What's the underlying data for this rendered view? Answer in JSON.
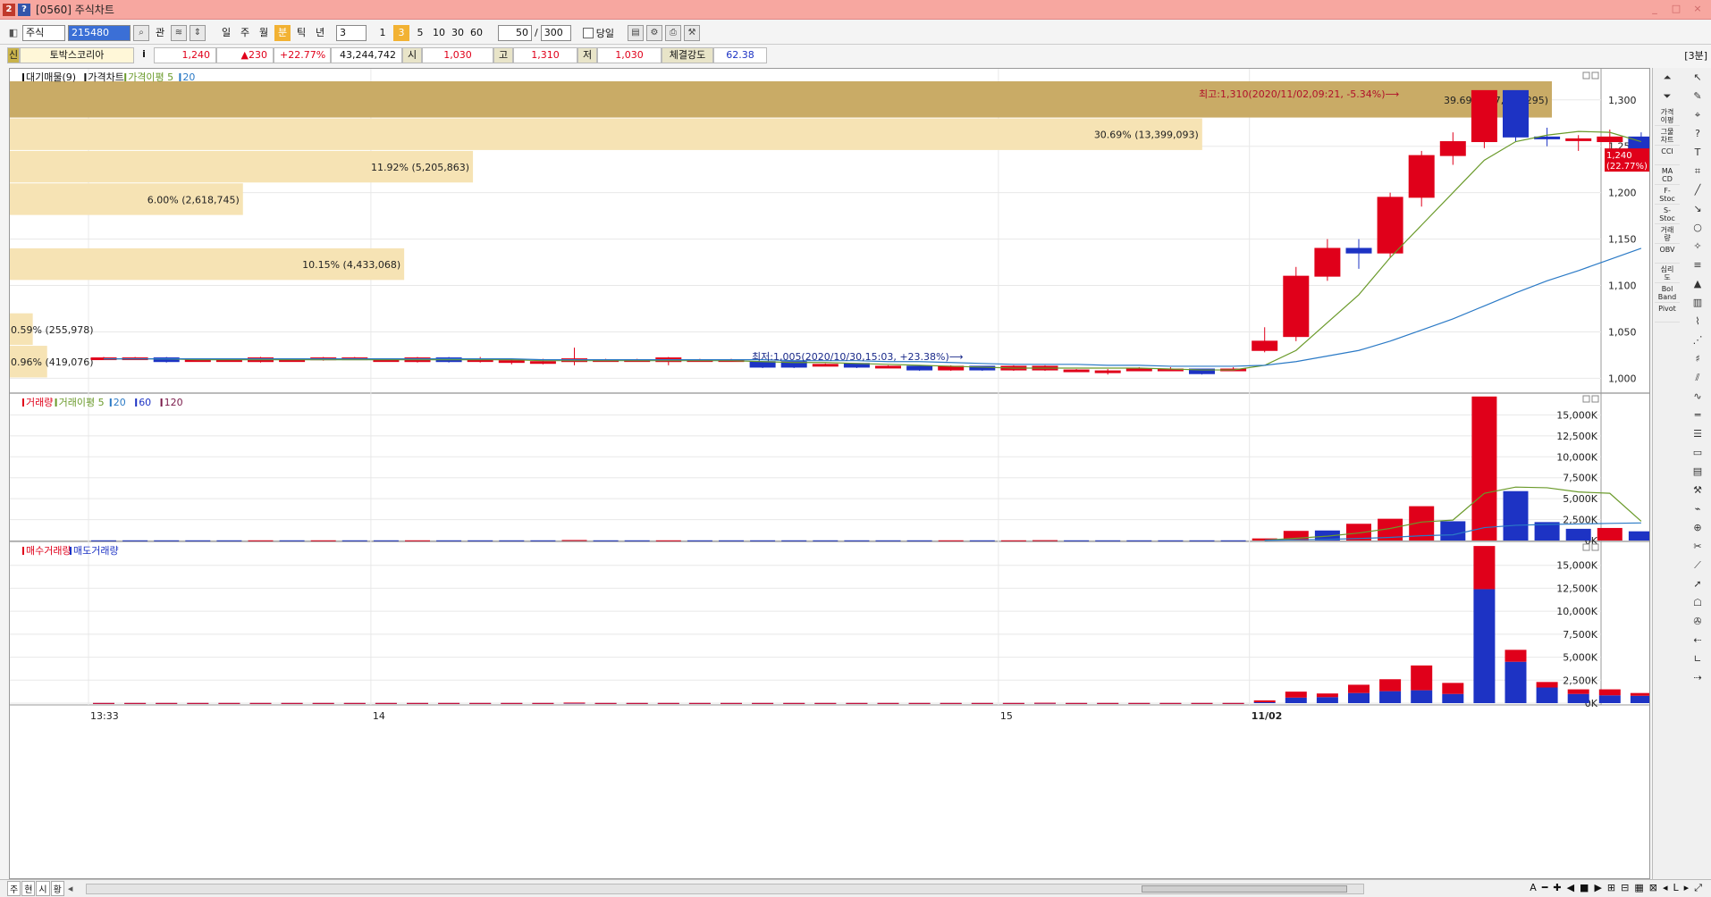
{
  "window": {
    "code": "2",
    "help": "?",
    "title": "[0560] 주식차트",
    "minimize": "_",
    "maximize": "□",
    "close": "×"
  },
  "toolbar": {
    "market": "주식",
    "code": "215480",
    "search": "⌕",
    "gwan": "관",
    "periods": [
      "일",
      "주",
      "월",
      "분",
      "틱",
      "년"
    ],
    "active_period": "분",
    "interval": "3",
    "minute_buttons": [
      "1",
      "3",
      "5",
      "10",
      "30",
      "60"
    ],
    "active_minute": "3",
    "display_count": "50",
    "slash": "/",
    "total_count": "300",
    "today_label": "당일"
  },
  "info": {
    "badge": "신",
    "name": "토박스코리아",
    "info_icon": "i",
    "price": "1,240",
    "change": "▲230",
    "change_pct": "+22.77%",
    "volume": "43,244,742",
    "open_label": "시",
    "open": "1,030",
    "high_label": "고",
    "high": "1,310",
    "low_label": "저",
    "low": "1,030",
    "strength_label": "체결강도",
    "strength": "62.38",
    "timeframe": "[3분]"
  },
  "colors": {
    "up": "#e0001a",
    "down": "#1d33c4",
    "ma5": "#6a9a2a",
    "ma20": "#2b7ac6",
    "profile_dark": "#c9ab66",
    "profile_light": "#f6e3b4"
  },
  "chart_data": [
    {
      "type": "candlestick",
      "panel": "price",
      "legend": [
        "대기매물(9)",
        "가격차트",
        "가격이평 5",
        "20"
      ],
      "y_ticks": [
        1000,
        1050,
        1100,
        1150,
        1200,
        1250,
        1300
      ],
      "y_tick_labels": [
        "1,000",
        "1,050",
        "1,100",
        "1,150",
        "1,200",
        "1,250",
        "1,300"
      ],
      "ylim": [
        985,
        1320
      ],
      "x_labels": [
        {
          "label": "13:33",
          "index": 0
        },
        {
          "label": "14",
          "index": 9
        },
        {
          "label": "15",
          "index": 29
        },
        {
          "label": "11/02",
          "index": 37
        }
      ],
      "candles": [
        {
          "o": 1022,
          "c": 1022,
          "h": 1023,
          "l": 1021
        },
        {
          "o": 1022,
          "c": 1022,
          "h": 1023,
          "l": 1021
        },
        {
          "o": 1022,
          "c": 1018,
          "h": 1023,
          "l": 1017
        },
        {
          "o": 1020,
          "c": 1020,
          "h": 1021,
          "l": 1019
        },
        {
          "o": 1020,
          "c": 1020,
          "h": 1021,
          "l": 1019
        },
        {
          "o": 1018,
          "c": 1022,
          "h": 1023,
          "l": 1017
        },
        {
          "o": 1020,
          "c": 1020,
          "h": 1021,
          "l": 1019
        },
        {
          "o": 1020,
          "c": 1022,
          "h": 1023,
          "l": 1019
        },
        {
          "o": 1022,
          "c": 1022,
          "h": 1023,
          "l": 1021
        },
        {
          "o": 1020,
          "c": 1020,
          "h": 1021,
          "l": 1019
        },
        {
          "o": 1018,
          "c": 1022,
          "h": 1023,
          "l": 1017
        },
        {
          "o": 1022,
          "c": 1018,
          "h": 1023,
          "l": 1017
        },
        {
          "o": 1020,
          "c": 1020,
          "h": 1023,
          "l": 1017
        },
        {
          "o": 1019,
          "c": 1019,
          "h": 1021,
          "l": 1015
        },
        {
          "o": 1018,
          "c": 1018,
          "h": 1021,
          "l": 1015
        },
        {
          "o": 1018,
          "c": 1021,
          "h": 1033,
          "l": 1014
        },
        {
          "o": 1020,
          "c": 1020,
          "h": 1021,
          "l": 1019
        },
        {
          "o": 1020,
          "c": 1020,
          "h": 1021,
          "l": 1019
        },
        {
          "o": 1018,
          "c": 1022,
          "h": 1023,
          "l": 1014
        },
        {
          "o": 1020,
          "c": 1020,
          "h": 1021,
          "l": 1019
        },
        {
          "o": 1020,
          "c": 1020,
          "h": 1021,
          "l": 1019
        },
        {
          "o": 1018,
          "c": 1012,
          "h": 1018,
          "l": 1011
        },
        {
          "o": 1018,
          "c": 1012,
          "h": 1018,
          "l": 1011
        },
        {
          "o": 1015,
          "c": 1015,
          "h": 1016,
          "l": 1014
        },
        {
          "o": 1016,
          "c": 1012,
          "h": 1016,
          "l": 1011
        },
        {
          "o": 1013,
          "c": 1013,
          "h": 1014,
          "l": 1012
        },
        {
          "o": 1013,
          "c": 1009,
          "h": 1013,
          "l": 1008
        },
        {
          "o": 1009,
          "c": 1013,
          "h": 1014,
          "l": 1008
        },
        {
          "o": 1013,
          "c": 1009,
          "h": 1013,
          "l": 1008
        },
        {
          "o": 1009,
          "c": 1013,
          "h": 1014,
          "l": 1008
        },
        {
          "o": 1009,
          "c": 1013,
          "h": 1014,
          "l": 1008
        },
        {
          "o": 1009,
          "c": 1009,
          "h": 1010,
          "l": 1007
        },
        {
          "o": 1008,
          "c": 1008,
          "h": 1010,
          "l": 1004
        },
        {
          "o": 1010,
          "c": 1010,
          "h": 1012,
          "l": 1008
        },
        {
          "o": 1010,
          "c": 1010,
          "h": 1012,
          "l": 1008
        },
        {
          "o": 1010,
          "c": 1005,
          "h": 1010,
          "l": 1004
        },
        {
          "o": 1010,
          "c": 1010,
          "h": 1012,
          "l": 1008
        },
        {
          "o": 1030,
          "c": 1040,
          "h": 1055,
          "l": 1028
        },
        {
          "o": 1045,
          "c": 1110,
          "h": 1120,
          "l": 1040
        },
        {
          "o": 1110,
          "c": 1140,
          "h": 1150,
          "l": 1105
        },
        {
          "o": 1140,
          "c": 1135,
          "h": 1150,
          "l": 1118
        },
        {
          "o": 1135,
          "c": 1195,
          "h": 1200,
          "l": 1130
        },
        {
          "o": 1195,
          "c": 1240,
          "h": 1245,
          "l": 1185
        },
        {
          "o": 1240,
          "c": 1255,
          "h": 1265,
          "l": 1230
        },
        {
          "o": 1255,
          "c": 1310,
          "h": 1310,
          "l": 1248
        },
        {
          "o": 1310,
          "c": 1260,
          "h": 1310,
          "l": 1255
        },
        {
          "o": 1260,
          "c": 1258,
          "h": 1270,
          "l": 1250
        },
        {
          "o": 1258,
          "c": 1258,
          "h": 1262,
          "l": 1245
        },
        {
          "o": 1255,
          "c": 1260,
          "h": 1268,
          "l": 1238
        },
        {
          "o": 1260,
          "c": 1240,
          "h": 1265,
          "l": 1238
        }
      ],
      "ma5": [
        1021,
        1021,
        1021,
        1020,
        1020,
        1020,
        1020,
        1020,
        1020,
        1020,
        1020,
        1020,
        1020,
        1020,
        1019,
        1019,
        1019,
        1019,
        1019,
        1019,
        1019,
        1018,
        1017,
        1017,
        1016,
        1015,
        1014,
        1013,
        1012,
        1011,
        1011,
        1011,
        1011,
        1011,
        1010,
        1009,
        1009,
        1014,
        1030,
        1060,
        1090,
        1130,
        1165,
        1200,
        1235,
        1255,
        1262,
        1266,
        1265,
        1255
      ],
      "ma20": [
        1021,
        1021,
        1021,
        1021,
        1021,
        1021,
        1021,
        1021,
        1021,
        1021,
        1021,
        1021,
        1021,
        1021,
        1020,
        1020,
        1020,
        1020,
        1020,
        1020,
        1020,
        1020,
        1019,
        1019,
        1019,
        1018,
        1018,
        1017,
        1016,
        1015,
        1015,
        1015,
        1014,
        1014,
        1013,
        1013,
        1013,
        1014,
        1018,
        1024,
        1030,
        1040,
        1052,
        1064,
        1078,
        1092,
        1105,
        1116,
        1128,
        1140
      ],
      "volume_profile": [
        {
          "low": 1280,
          "high": 1320,
          "label": "39.69% (17,331,295)",
          "pct": 39.69
        },
        {
          "low": 1245,
          "high": 1280,
          "label": "30.69% (13,399,093)",
          "pct": 30.69
        },
        {
          "low": 1210,
          "high": 1245,
          "label": "11.92% (5,205,863)",
          "pct": 11.92
        },
        {
          "low": 1175,
          "high": 1210,
          "label": "6.00% (2,618,745)",
          "pct": 6.0
        },
        {
          "low": 1105,
          "high": 1140,
          "label": "10.15% (4,433,068)",
          "pct": 10.15
        },
        {
          "low": 1035,
          "high": 1070,
          "label": "0.59% (255,978)",
          "pct": 0.59
        },
        {
          "low": 1000,
          "high": 1035,
          "label": "0.96% (419,076)",
          "pct": 0.96
        }
      ],
      "annotations": [
        {
          "text": "최고:1,310(2020/11/02,09:21, -5.34%)⟶",
          "color": "#b0102a"
        },
        {
          "text": "최저:1,005(2020/10/30,15:03, +23.38%)⟶",
          "color": "#1a2a8a"
        }
      ],
      "last_price_tag": [
        "1,240",
        "(22.77%)"
      ]
    },
    {
      "type": "bar",
      "panel": "volume",
      "legend": [
        "거래량",
        "거래이평 5",
        "20",
        "60",
        "120"
      ],
      "y_tick_labels": [
        "0K",
        "2,500K",
        "5,000K",
        "7,500K",
        "10,000K",
        "12,500K",
        "15,000K"
      ],
      "ylim": [
        0,
        17500
      ],
      "values": [
        20,
        20,
        20,
        20,
        20,
        20,
        20,
        20,
        20,
        20,
        20,
        20,
        20,
        20,
        20,
        60,
        20,
        20,
        20,
        20,
        20,
        20,
        20,
        20,
        20,
        20,
        20,
        20,
        20,
        20,
        40,
        20,
        20,
        20,
        20,
        20,
        20,
        250,
        1150,
        1200,
        2000,
        2600,
        4100,
        2300,
        17200,
        5900,
        2200,
        1400,
        1500,
        1100
      ],
      "up": [
        0,
        0,
        0,
        0,
        0,
        1,
        0,
        1,
        0,
        0,
        1,
        0,
        0,
        0,
        0,
        1,
        0,
        0,
        1,
        0,
        0,
        0,
        0,
        0,
        0,
        0,
        0,
        1,
        0,
        1,
        1,
        0,
        0,
        0,
        0,
        0,
        0,
        1,
        1,
        0,
        1,
        1,
        1,
        0,
        1,
        0,
        0,
        0,
        1,
        0
      ],
      "ma5": [
        null,
        null,
        null,
        null,
        null,
        null,
        null,
        null,
        null,
        null,
        null,
        null,
        null,
        null,
        null,
        null,
        null,
        null,
        null,
        null,
        null,
        null,
        null,
        null,
        null,
        null,
        null,
        null,
        null,
        null,
        null,
        null,
        null,
        null,
        null,
        null,
        null,
        40,
        270,
        520,
        900,
        1440,
        2210,
        2440,
        5640,
        6380,
        6300,
        5800,
        5640,
        2300
      ],
      "ma20": [
        null,
        null,
        null,
        null,
        null,
        null,
        null,
        null,
        null,
        null,
        null,
        null,
        null,
        null,
        null,
        null,
        null,
        null,
        null,
        null,
        null,
        null,
        null,
        null,
        null,
        null,
        null,
        null,
        null,
        null,
        null,
        null,
        null,
        null,
        null,
        null,
        null,
        30,
        80,
        140,
        240,
        370,
        570,
        680,
        1540,
        1820,
        1920,
        1980,
        2050,
        2100
      ]
    },
    {
      "type": "stacked-bar",
      "panel": "buy-sell-volume",
      "legend": [
        "매수거래량",
        "매도거래량"
      ],
      "y_tick_labels": [
        "0K",
        "2,500K",
        "5,000K",
        "7,500K",
        "10,000K",
        "12,500K",
        "15,000K"
      ],
      "ylim": [
        0,
        17500
      ],
      "buy": [
        10,
        10,
        10,
        10,
        10,
        10,
        10,
        10,
        10,
        10,
        10,
        10,
        10,
        10,
        10,
        30,
        10,
        10,
        10,
        10,
        10,
        10,
        10,
        10,
        10,
        10,
        10,
        10,
        10,
        10,
        20,
        10,
        10,
        10,
        10,
        10,
        10,
        200,
        650,
        400,
        900,
        1300,
        2700,
        1200,
        4700,
        1300,
        600,
        500,
        650,
        300
      ],
      "sell": [
        10,
        10,
        10,
        10,
        10,
        10,
        10,
        10,
        10,
        10,
        10,
        10,
        10,
        10,
        10,
        30,
        10,
        10,
        10,
        10,
        10,
        10,
        10,
        10,
        10,
        10,
        10,
        10,
        10,
        10,
        20,
        10,
        10,
        10,
        10,
        10,
        10,
        100,
        600,
        650,
        1100,
        1300,
        1400,
        1000,
        12400,
        4500,
        1700,
        1000,
        850,
        800
      ]
    }
  ],
  "sidebar": {
    "indicators": [
      "가격\n이평",
      "그물\n차트",
      "CCI",
      "MA\nCD",
      "F-\nStoc",
      "S-\nStoc",
      "거래\n량",
      "OBV",
      "심리\n도",
      "Bol\nBand",
      "Pivot"
    ],
    "tools": [
      "↖",
      "✎",
      "⌖",
      "?",
      "T",
      "⌗",
      "╱",
      "↘",
      "○",
      "✧",
      "≡",
      "▲",
      "▥",
      "⌇",
      "⋰",
      "♯",
      "⫽",
      "∿",
      "═",
      "☰",
      "▭",
      "▤",
      "⚒",
      "⌁",
      "⊕",
      "✂",
      "⟋",
      "➚",
      "☖",
      "✇",
      "⇠",
      "∟",
      "⇢"
    ]
  },
  "status": {
    "tabs": [
      "주",
      "현",
      "시",
      "황"
    ],
    "nav": [
      "A",
      "━",
      "✚",
      "◀",
      "■",
      "▶",
      "⊞",
      "⊟",
      "▦",
      "⊠",
      "◂",
      "L",
      "▸",
      "⤢"
    ]
  }
}
